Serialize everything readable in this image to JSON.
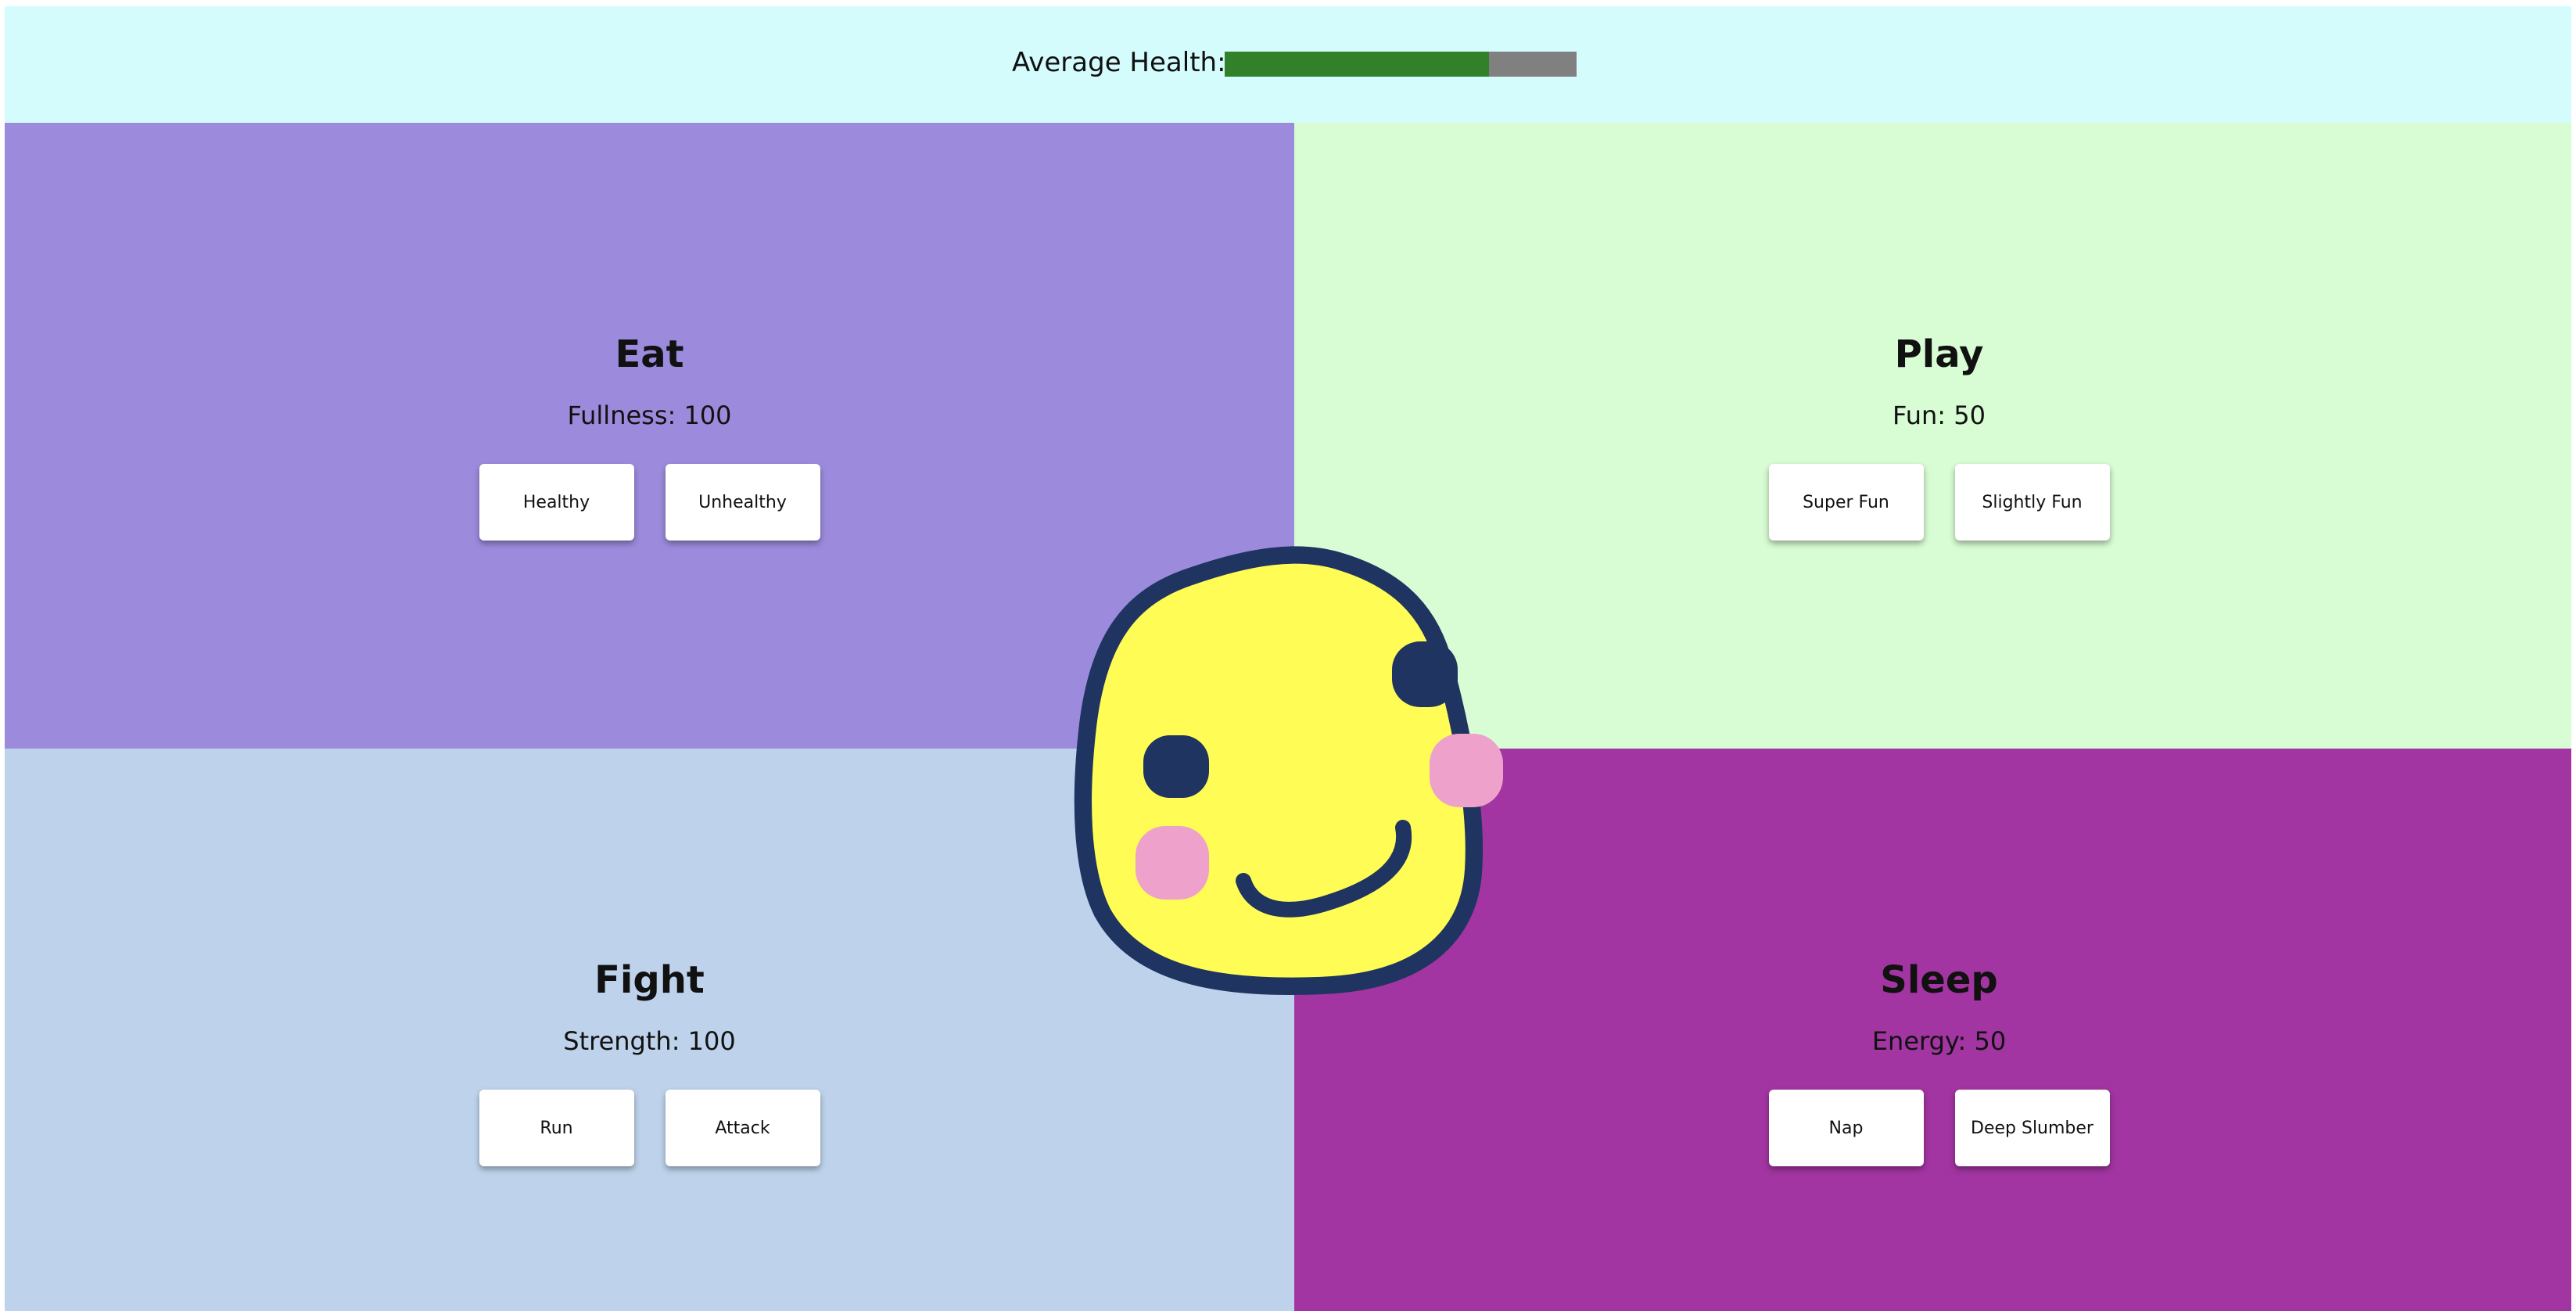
{
  "header": {
    "average_health_label": "Average Health:",
    "average_health_fraction": 0.75,
    "health_fill_color": "#33802a",
    "health_empty_color": "#808080"
  },
  "quadrants": {
    "eat": {
      "title": "Eat",
      "stat": "Fullness: 100",
      "buttons": [
        "Healthy",
        "Unhealthy"
      ],
      "color": "#9c8bdc"
    },
    "play": {
      "title": "Play",
      "stat": "Fun: 50",
      "buttons": [
        "Super Fun",
        "Slightly Fun"
      ],
      "color": "#d8fcd4"
    },
    "fight": {
      "title": "Fight",
      "stat": "Strength: 100",
      "buttons": [
        "Run",
        "Attack"
      ],
      "color": "#bed3eb"
    },
    "sleep": {
      "title": "Sleep",
      "stat": "Energy: 50",
      "buttons": [
        "Nap",
        "Deep Slumber"
      ],
      "color": "#a235a1"
    }
  },
  "pet": {
    "icon": "smiley-pet-icon",
    "body_color": "#fffd55",
    "outline_color": "#1f3461",
    "cheek_color": "#eea1ca"
  }
}
